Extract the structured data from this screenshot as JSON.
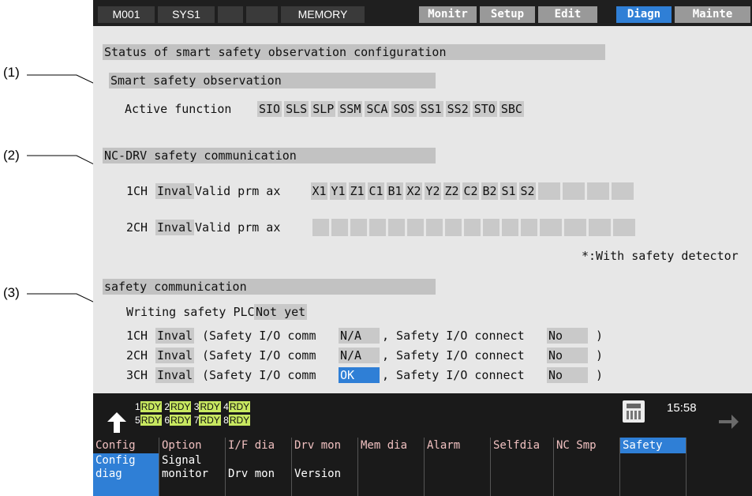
{
  "callouts": [
    "(1)",
    "(2)",
    "(3)"
  ],
  "topbar": {
    "cells": [
      "M001",
      "SYS1",
      "",
      "",
      "MEMORY"
    ],
    "tabs": [
      {
        "label": "Monitr",
        "active": false
      },
      {
        "label": "Setup",
        "active": false
      },
      {
        "label": "Edit",
        "active": false
      },
      {
        "label": "Diagn",
        "active": true
      },
      {
        "label": "Mainte",
        "active": false
      }
    ]
  },
  "page": {
    "title": "Status of smart safety observation configuration",
    "smart": {
      "header": "Smart safety observation",
      "label": "Active function",
      "functions": [
        "SIO",
        "SLS",
        "SLP",
        "SSM",
        "SCA",
        "SOS",
        "SS1",
        "SS2",
        "STO",
        "SBC"
      ]
    },
    "ncdrv": {
      "header": "NC-DRV safety communication",
      "ch1_label": "1CH",
      "ch1_status": "Inval",
      "ch1_valid_label": "Valid prm ax",
      "ch1_axes": [
        "X1",
        "Y1",
        "Z1",
        "C1",
        "B1",
        "X2",
        "Y2",
        "Z2",
        "C2",
        "B2",
        "S1",
        "S2",
        "",
        "",
        "",
        "",
        ""
      ],
      "ch2_label": "2CH",
      "ch2_status": "Inval",
      "ch2_valid_label": "Valid prm ax",
      "ch2_axes": [
        "",
        "",
        "",
        "",
        "",
        "",
        "",
        "",
        "",
        "",
        "",
        "",
        "",
        "",
        "",
        "",
        "",
        "",
        "",
        ""
      ],
      "note": "*:With safety detector"
    },
    "safety": {
      "header": "safety communication",
      "writing_label": "Writing safety PLC",
      "writing_value": "Not yet",
      "channels": [
        {
          "ch": "1CH",
          "status": "Inval",
          "comm_label": "(Safety I/O comm",
          "comm": "N/A",
          "connect_label": ", Safety I/O connect",
          "connect": "No",
          "close": ")",
          "highlight": false
        },
        {
          "ch": "2CH",
          "status": "Inval",
          "comm_label": "(Safety I/O comm",
          "comm": "N/A",
          "connect_label": ", Safety I/O connect",
          "connect": "No",
          "close": ")",
          "highlight": false
        },
        {
          "ch": "3CH",
          "status": "Inval",
          "comm_label": "(Safety I/O comm",
          "comm": "OK",
          "connect_label": ", Safety I/O connect",
          "connect": "No",
          "close": ")",
          "highlight": true
        }
      ]
    }
  },
  "status": {
    "rdy": [
      {
        "n": "1",
        "t": "RDY"
      },
      {
        "n": "2",
        "t": "RDY"
      },
      {
        "n": "3",
        "t": "RDY"
      },
      {
        "n": "4",
        "t": "RDY"
      },
      {
        "n": "5",
        "t": "RDY"
      },
      {
        "n": "6",
        "t": "RDY"
      },
      {
        "n": "7",
        "t": "RDY"
      },
      {
        "n": "8",
        "t": "RDY"
      }
    ],
    "time": "15:58",
    "icons": {
      "up": "up-arrow-icon",
      "calc": "calculator-icon",
      "next": "right-arrow-icon"
    }
  },
  "function_keys": [
    "Config",
    "Option",
    "I/F dia",
    "Drv mon",
    "Mem dia",
    "Alarm",
    "Selfdia",
    "NC Smp",
    "Safety",
    ""
  ],
  "function_active": 8,
  "soft_keys": [
    {
      "lines": [
        "Config",
        "diag"
      ],
      "active": true
    },
    {
      "lines": [
        "Signal",
        "monitor"
      ],
      "active": false
    },
    {
      "lines": [
        "Drv mon"
      ],
      "active": false
    },
    {
      "lines": [
        "Version"
      ],
      "active": false
    },
    {
      "lines": [],
      "active": false
    },
    {
      "lines": [],
      "active": false
    },
    {
      "lines": [],
      "active": false
    },
    {
      "lines": [],
      "active": false
    },
    {
      "lines": [],
      "active": false
    },
    {
      "lines": [],
      "active": false
    }
  ]
}
